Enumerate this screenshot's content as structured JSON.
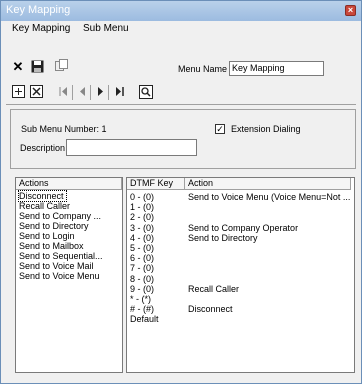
{
  "window": {
    "title": "Key Mapping",
    "close_glyph": "×"
  },
  "menu": {
    "items": [
      "Key Mapping",
      "Sub Menu"
    ]
  },
  "toolbar1": {
    "icons": [
      "delete-icon",
      "save-icon",
      "copy-icon"
    ]
  },
  "toolbar2": {
    "icons": [
      "add-node-icon",
      "remove-node-icon",
      "first-icon",
      "prev-icon",
      "next-icon",
      "last-icon",
      "preview-icon"
    ]
  },
  "menu_name": {
    "label": "Menu Name",
    "value": "Key Mapping"
  },
  "submenu": {
    "number_label": "Sub Menu Number: 1",
    "description_label": "Description",
    "description_value": ""
  },
  "extension_dialing": {
    "label": "Extension Dialing",
    "checked": true
  },
  "actions": {
    "header": "Actions",
    "items": [
      "Disconnect",
      "Recall Caller",
      "Send to Company ...",
      "Send to Directory",
      "Send to Login",
      "Send to Mailbox",
      "Send to Sequential...",
      "Send to Voice Mail",
      "Send to Voice Menu"
    ]
  },
  "mapping": {
    "headers": [
      "DTMF Key",
      "Action"
    ],
    "rows": [
      {
        "key": "0 - (0)",
        "action": "Send to Voice Menu (Voice Menu=Not ..."
      },
      {
        "key": "1 - (0)",
        "action": ""
      },
      {
        "key": "2 - (0)",
        "action": ""
      },
      {
        "key": "3 - (0)",
        "action": "Send to Company Operator"
      },
      {
        "key": "4 - (0)",
        "action": "Send to Directory"
      },
      {
        "key": "5 - (0)",
        "action": ""
      },
      {
        "key": "6 - (0)",
        "action": ""
      },
      {
        "key": "7 - (0)",
        "action": ""
      },
      {
        "key": "8 - (0)",
        "action": ""
      },
      {
        "key": "9 - (0)",
        "action": "Recall Caller"
      },
      {
        "key": "* - (*)",
        "action": ""
      },
      {
        "key": "# - (#)",
        "action": "Disconnect"
      },
      {
        "key": "Default",
        "action": ""
      }
    ]
  }
}
